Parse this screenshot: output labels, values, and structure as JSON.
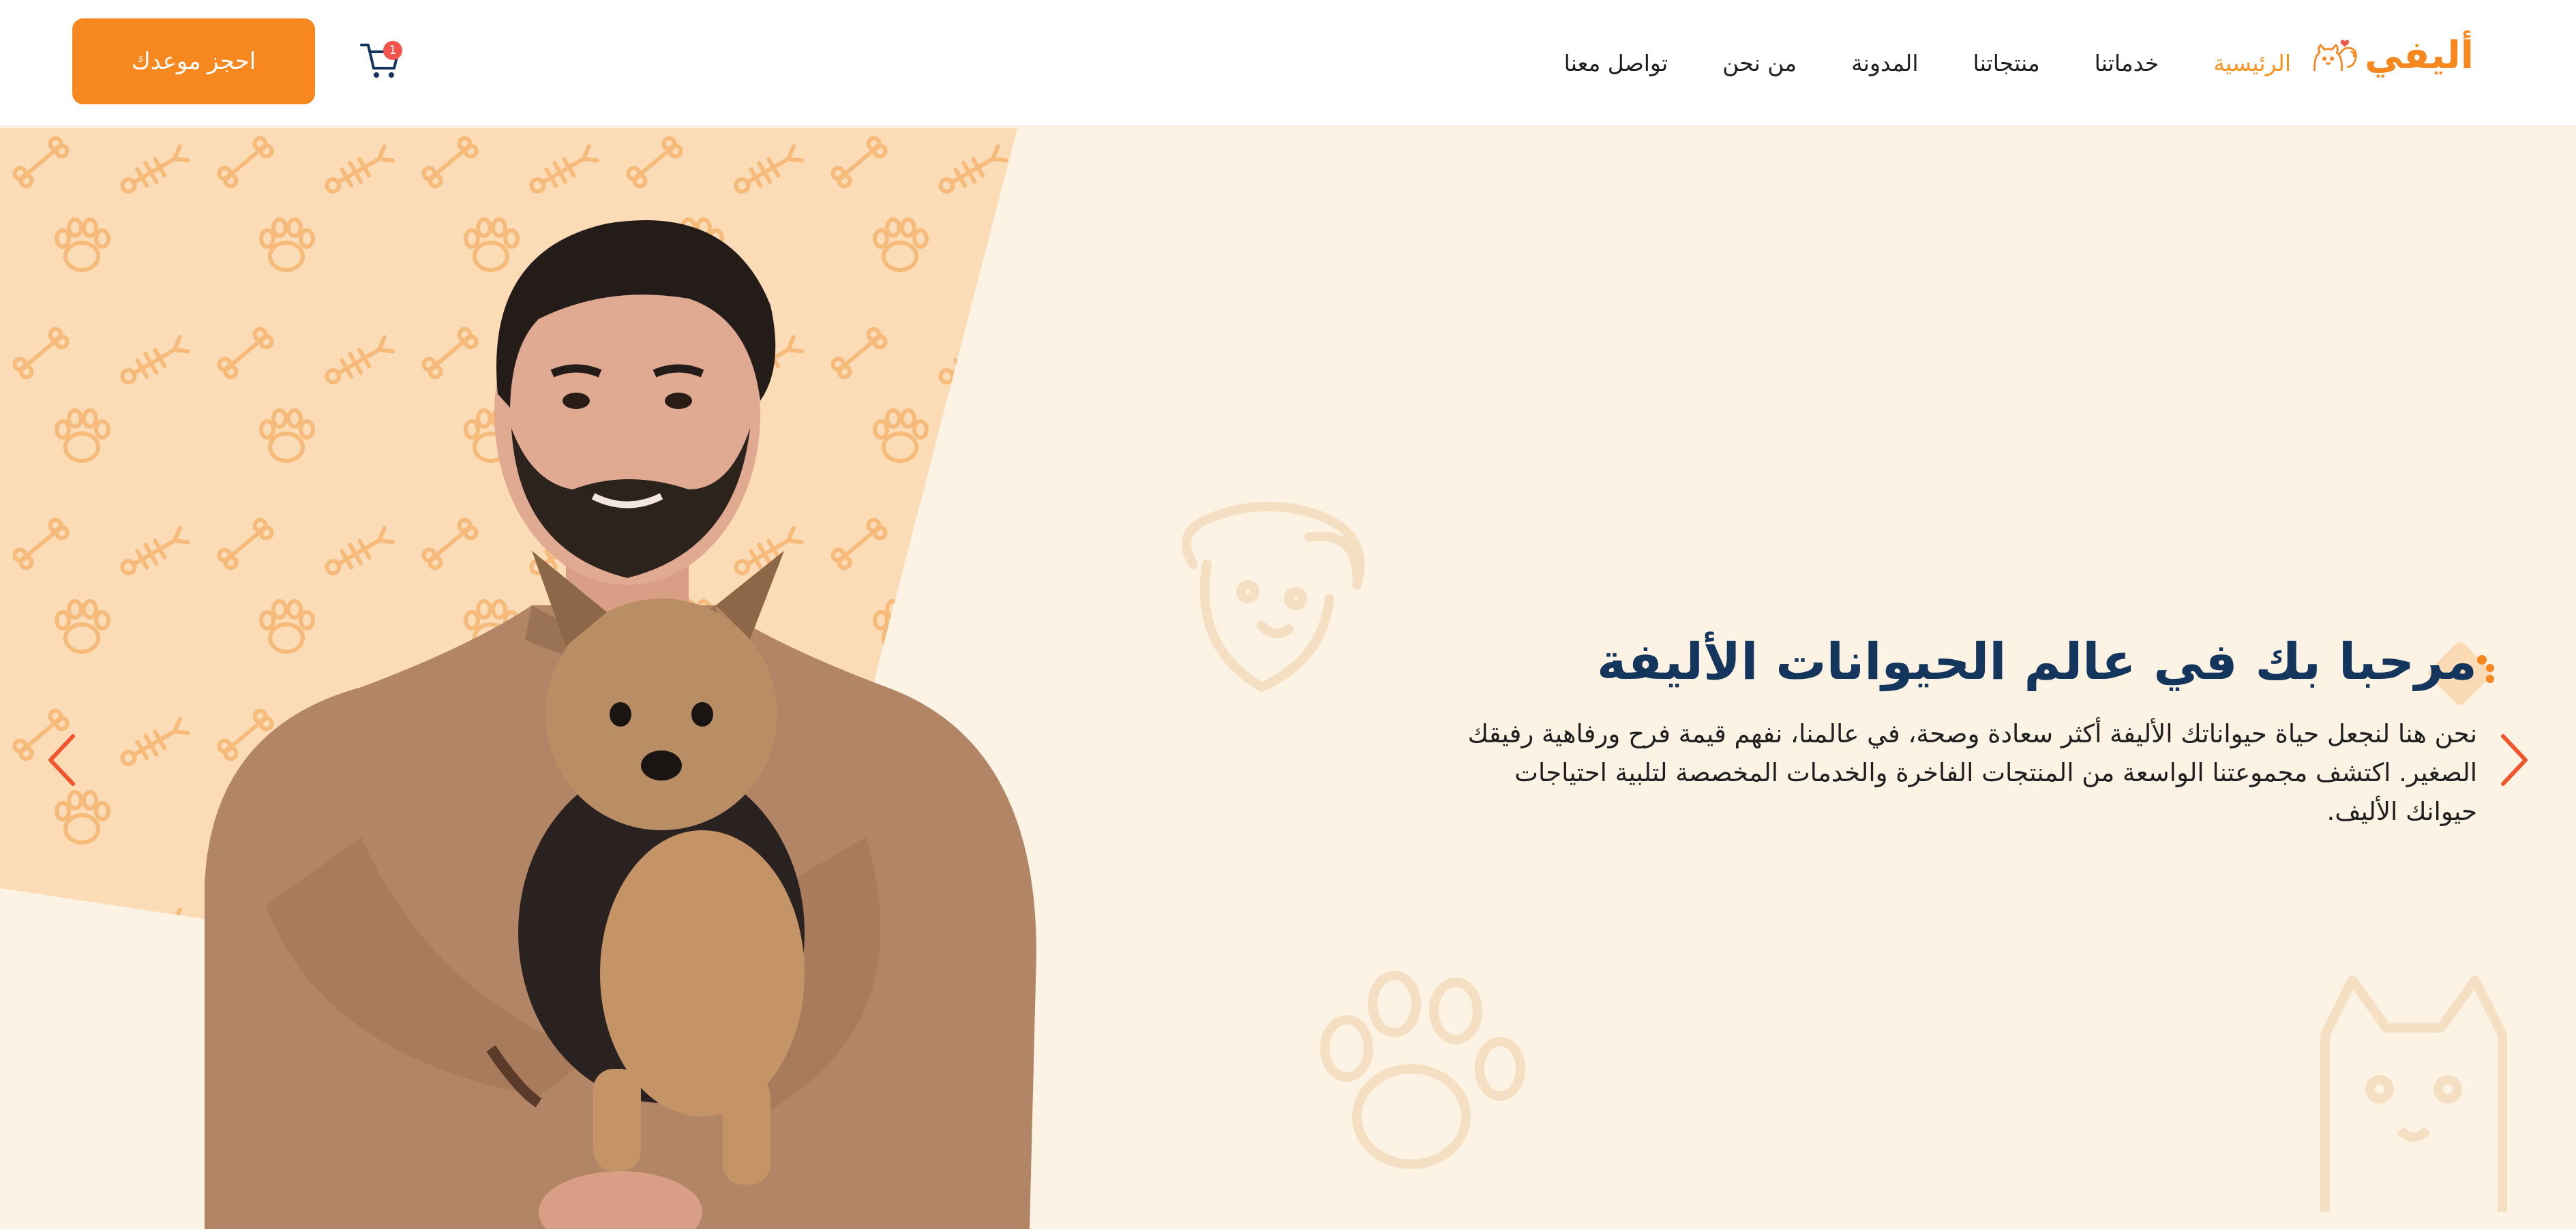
{
  "brand": {
    "name": "أليفي"
  },
  "nav": {
    "items": [
      {
        "label": "الرئيسية",
        "active": true
      },
      {
        "label": "خدماتنا",
        "active": false
      },
      {
        "label": "منتجاتنا",
        "active": false
      },
      {
        "label": "المدونة",
        "active": false
      },
      {
        "label": "من نحن",
        "active": false
      },
      {
        "label": "تواصل معنا",
        "active": false
      }
    ]
  },
  "cart": {
    "count": "1",
    "icon": "cart-icon"
  },
  "cta": {
    "label": "احجز موعدك"
  },
  "hero": {
    "title": "مرحبا بك في عالم الحيوانات الأليفة",
    "description": "نحن هنا لنجعل حياة حيواناتك الأليفة أكثر سعادة وصحة، في عالمنا، نفهم قيمة فرح ورفاهية رفيقك الصغير. اكتشف مجموعتنا الواسعة من المنتجات الفاخرة والخدمات المخصصة لتلبية احتياجات حيوانك الأليف.",
    "prev_icon": "chevron-left-icon",
    "next_icon": "chevron-right-icon"
  },
  "colors": {
    "accent": "#f7871f",
    "title": "#14355c",
    "background": "#fdf3e5",
    "panel": "#fcdcb6",
    "badge": "#f2534a"
  }
}
